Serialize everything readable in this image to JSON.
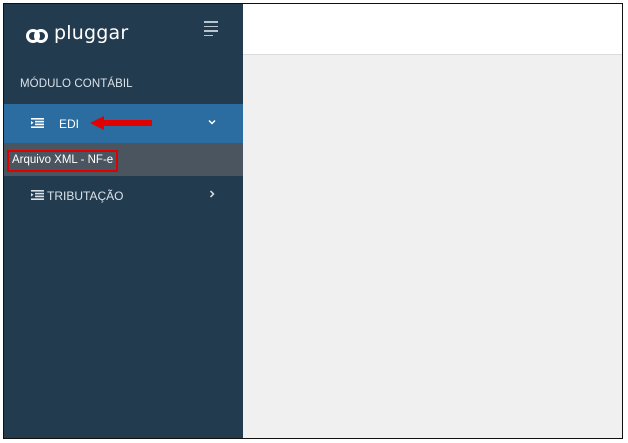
{
  "brand": {
    "logo_text": "pluggar",
    "logo_icon": "pluggar-logo-icon"
  },
  "sidebar": {
    "toggle_icon": "hamburger-icon",
    "module_label": "MÓDULO CONTÁBIL",
    "items": [
      {
        "label": "EDI",
        "icon": "indent-list-icon",
        "expanded": true,
        "chevron": "chevron-down-icon",
        "children": [
          {
            "label": "Arquivo XML - NF-e"
          }
        ]
      },
      {
        "label": "TRIBUTAÇÃO",
        "icon": "indent-list-icon",
        "expanded": false,
        "chevron": "chevron-right-icon"
      }
    ]
  },
  "annotations": {
    "arrow_color": "#e00000",
    "highlight_color": "#e00000"
  },
  "colors": {
    "sidebar_bg": "#233b4f",
    "active_bg": "#2b6da0",
    "submenu_bg": "#4a5560",
    "content_bg": "#f0f0f0"
  }
}
